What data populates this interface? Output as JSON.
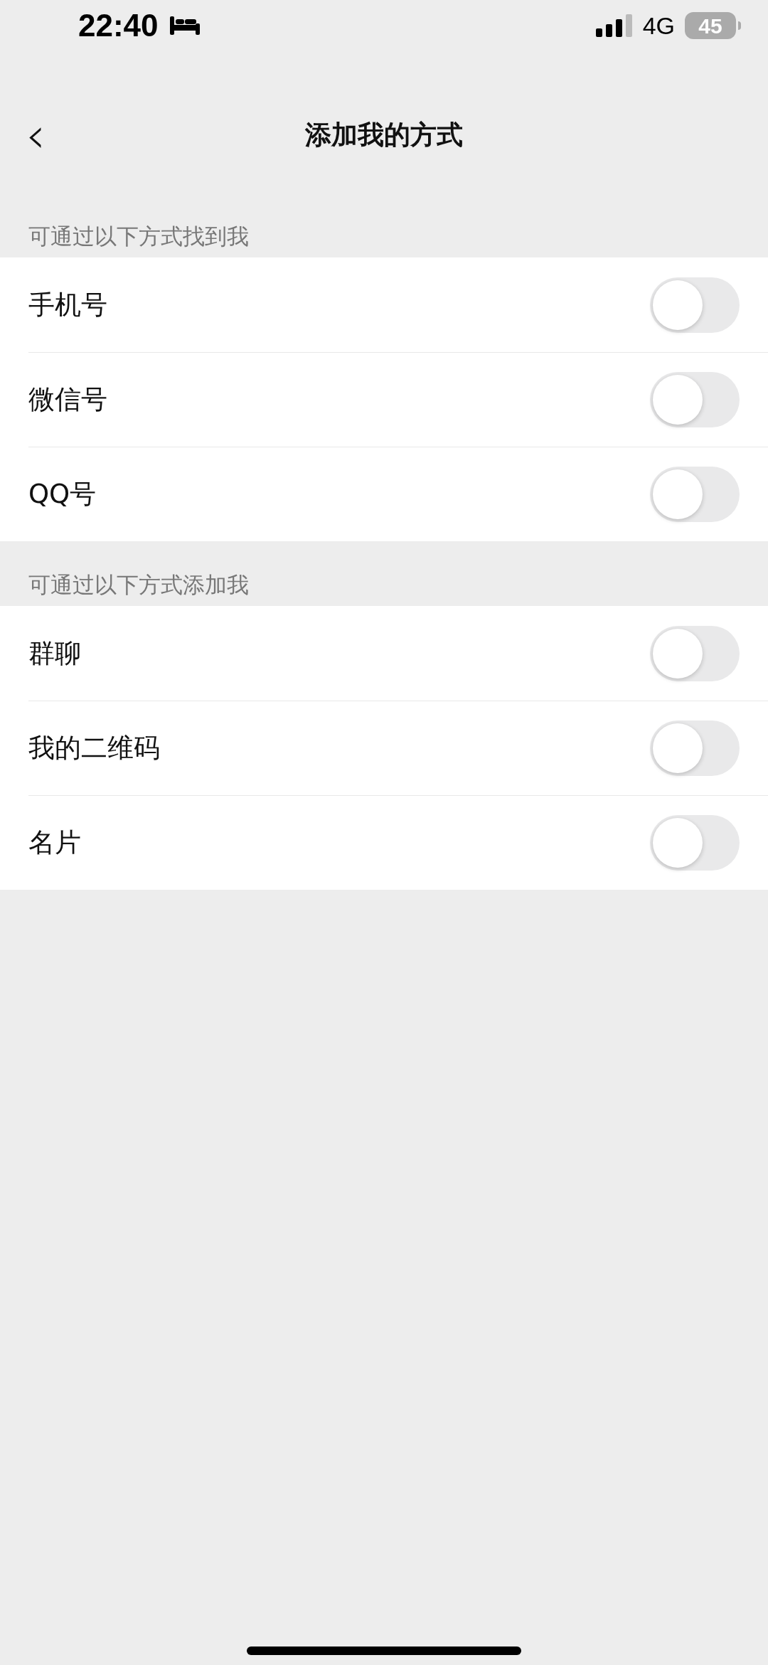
{
  "status_bar": {
    "time": "22:40",
    "network": "4G",
    "battery": "45"
  },
  "nav": {
    "back": "‹",
    "title": "添加我的方式"
  },
  "sections": [
    {
      "header": "可通过以下方式找到我",
      "items": [
        {
          "label": "手机号",
          "on": false
        },
        {
          "label": "微信号",
          "on": false
        },
        {
          "label": "QQ号",
          "on": false
        }
      ]
    },
    {
      "header": "可通过以下方式添加我",
      "items": [
        {
          "label": "群聊",
          "on": false
        },
        {
          "label": "我的二维码",
          "on": false
        },
        {
          "label": "名片",
          "on": false
        }
      ]
    }
  ]
}
